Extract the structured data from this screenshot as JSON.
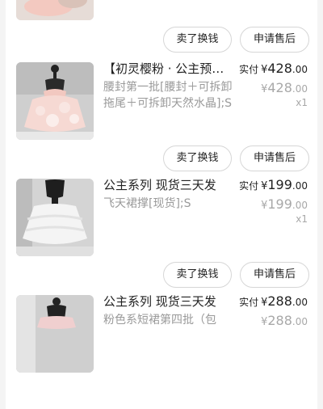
{
  "actions": {
    "sell_label": "卖了换钱",
    "after_sale_label": "申请售后"
  },
  "orders": [
    {
      "title": "【初灵樱粉 · 公主预…",
      "spec": "腰封第一批[腰封＋可拆卸拖尾＋可拆卸天然水晶];S",
      "paid_label": "实付",
      "currency": "¥",
      "paid_int": "428",
      "paid_dec": ".00",
      "orig_int": "428",
      "orig_dec": ".00",
      "qty": "x1",
      "image_icon": "pink-tutu-dress-thumbnail"
    },
    {
      "title": "公主系列 现货三天发",
      "spec": "飞天裙撑[现货];S",
      "paid_label": "实付",
      "currency": "¥",
      "paid_int": "199",
      "paid_dec": ".00",
      "orig_int": "199",
      "orig_dec": ".00",
      "qty": "x1",
      "image_icon": "white-tutu-skirt-thumbnail"
    },
    {
      "title": "公主系列 现货三天发",
      "spec": "粉色系短裙第四批（包",
      "paid_label": "实付",
      "currency": "¥",
      "paid_int": "288",
      "paid_dec": ".00",
      "orig_int": "288",
      "orig_dec": ".00",
      "qty": "",
      "image_icon": "dress-on-mannequin-thumbnail"
    }
  ]
}
